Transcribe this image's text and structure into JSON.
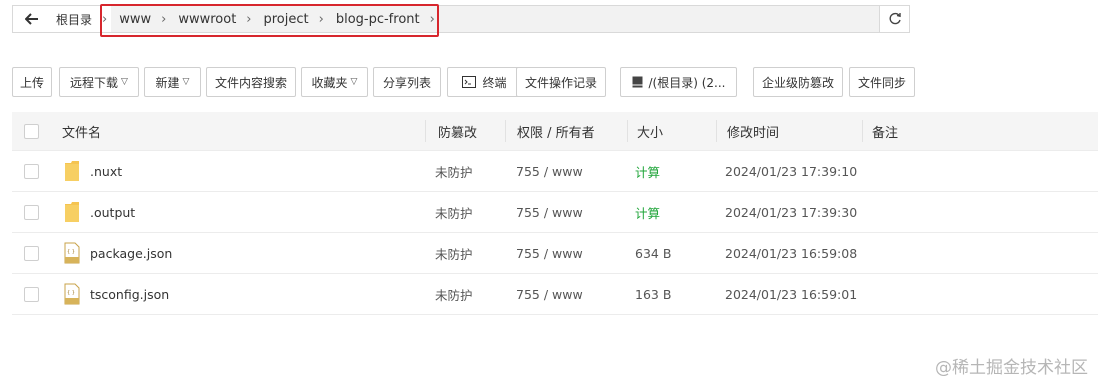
{
  "path": {
    "root": "根目录",
    "segments": [
      "www",
      "wwwroot",
      "project",
      "blog-pc-front"
    ]
  },
  "toolbar": {
    "upload": "上传",
    "remote_download": "远程下载",
    "new": "新建",
    "content_search": "文件内容搜索",
    "favorites": "收藏夹",
    "share_list": "分享列表",
    "terminal": "终端",
    "file_op_log": "文件操作记录",
    "disk": "/(根目录) (2...",
    "tamper_proof": "企业级防篡改",
    "file_sync": "文件同步"
  },
  "table": {
    "headers": {
      "name": "文件名",
      "tamper": "防篡改",
      "perm": "权限 / 所有者",
      "size": "大小",
      "mtime": "修改时间",
      "note": "备注"
    },
    "rows": [
      {
        "name": ".nuxt",
        "type": "folder",
        "tamper": "未防护",
        "perm": "755 / www",
        "size": "计算",
        "mtime": "2024/01/23 17:39:10"
      },
      {
        "name": ".output",
        "type": "folder",
        "tamper": "未防护",
        "perm": "755 / www",
        "size": "计算",
        "mtime": "2024/01/23 17:39:30"
      },
      {
        "name": "package.json",
        "type": "json",
        "tamper": "未防护",
        "perm": "755 / www",
        "size": "634 B",
        "mtime": "2024/01/23 16:59:08"
      },
      {
        "name": "tsconfig.json",
        "type": "json",
        "tamper": "未防护",
        "perm": "755 / www",
        "size": "163 B",
        "mtime": "2024/01/23 16:59:01"
      }
    ]
  },
  "colors": {
    "highlight": "#d7262d",
    "calc": "#20a53a",
    "folder": "#f5c451"
  },
  "watermark": "@稀土掘金技术社区"
}
